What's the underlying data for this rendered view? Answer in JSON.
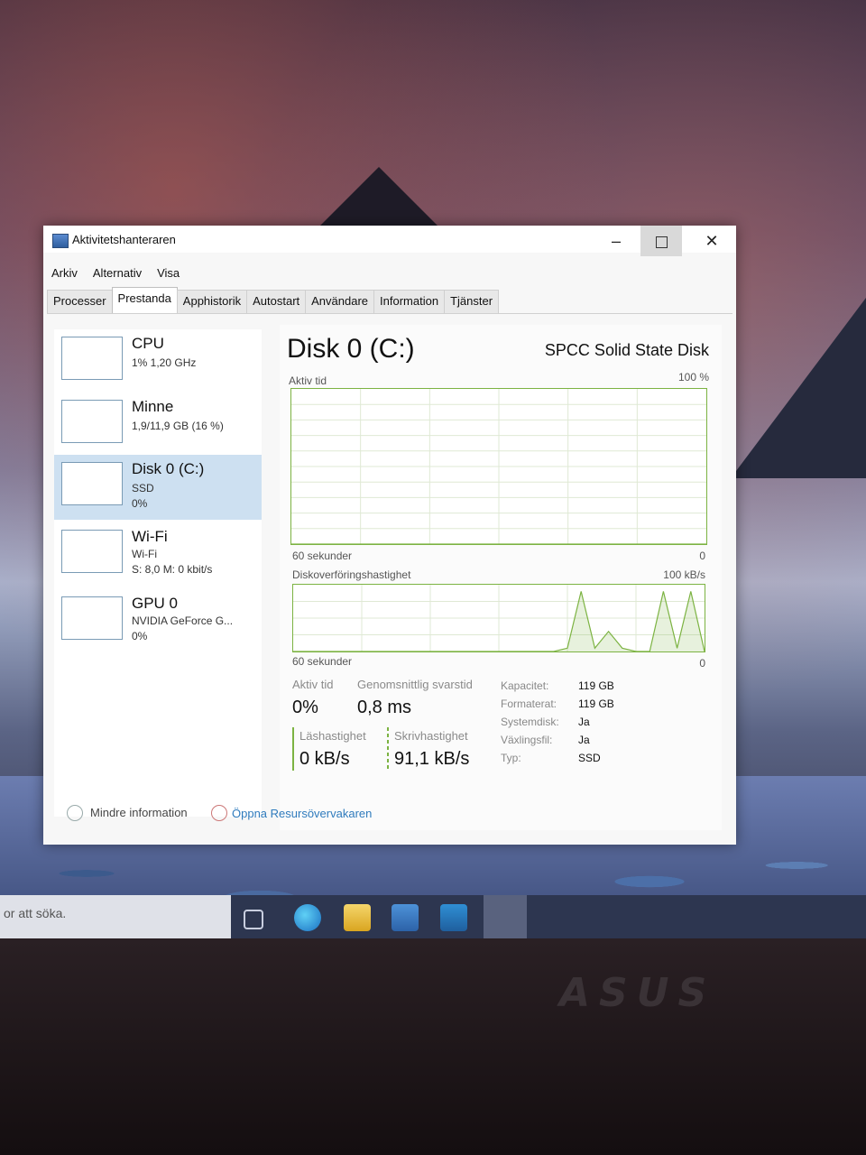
{
  "window": {
    "title": "Aktivitetshanteraren",
    "min_glyph": "–",
    "close_glyph": "✕"
  },
  "menu": [
    "Arkiv",
    "Alternativ",
    "Visa"
  ],
  "tabs": [
    "Processer",
    "Prestanda",
    "Apphistorik",
    "Autostart",
    "Användare",
    "Information",
    "Tjänster"
  ],
  "active_tab": "Prestanda",
  "sidebar": [
    {
      "title": "CPU",
      "lines": [
        "1% 1,20 GHz"
      ]
    },
    {
      "title": "Minne",
      "lines": [
        "1,9/11,9 GB (16 %)"
      ]
    },
    {
      "title": "Disk 0 (C:)",
      "lines": [
        "SSD",
        "0%"
      ]
    },
    {
      "title": "Wi-Fi",
      "lines": [
        "Wi-Fi",
        "S: 8,0 M: 0 kbit/s"
      ]
    },
    {
      "title": "GPU 0",
      "lines": [
        "NVIDIA GeForce G...",
        "0%"
      ]
    }
  ],
  "selected_sidebar_index": 2,
  "main": {
    "title": "Disk 0 (C:)",
    "model": "SPCC Solid State Disk",
    "graph1": {
      "label": "Aktiv tid",
      "max": "100 %",
      "time": "60 sekunder",
      "min": "0"
    },
    "graph2": {
      "label": "Diskoverföringshastighet",
      "max": "100 kB/s",
      "time": "60 sekunder",
      "min": "0"
    },
    "stats": {
      "active_label": "Aktiv tid",
      "active_value": "0%",
      "resp_label": "Genomsnittlig svarstid",
      "resp_value": "0,8 ms",
      "read_label": "Läshastighet",
      "read_value": "0 kB/s",
      "write_label": "Skrivhastighet",
      "write_value": "91,1 kB/s"
    },
    "details": [
      {
        "key": "Kapacitet:",
        "value": "119 GB"
      },
      {
        "key": "Formaterat:",
        "value": "119 GB"
      },
      {
        "key": "Systemdisk:",
        "value": "Ja"
      },
      {
        "key": "Växlingsfil:",
        "value": "Ja"
      },
      {
        "key": "Typ:",
        "value": "SSD"
      }
    ]
  },
  "footer": {
    "less_info": "Mindre information",
    "open_monitor": "Öppna Resursövervakaren"
  },
  "taskbar": {
    "search_placeholder": "or att söka."
  },
  "colors": {
    "graph_line": "#7cb342",
    "selected_bg": "#cde0f1",
    "link": "#2f7bbd"
  },
  "chart_data": [
    {
      "type": "line",
      "label": "Aktiv tid",
      "ylim": [
        0,
        100
      ],
      "x": [
        0,
        60
      ],
      "values": [
        0,
        0
      ]
    },
    {
      "type": "line",
      "label": "Diskoverföringshastighet",
      "ylim": [
        0,
        100
      ],
      "x": [
        0,
        38,
        40,
        42,
        44,
        46,
        48,
        50,
        52,
        54,
        56,
        58,
        60
      ],
      "values": [
        0,
        0,
        5,
        90,
        5,
        30,
        5,
        0,
        0,
        90,
        5,
        90,
        0
      ]
    }
  ]
}
